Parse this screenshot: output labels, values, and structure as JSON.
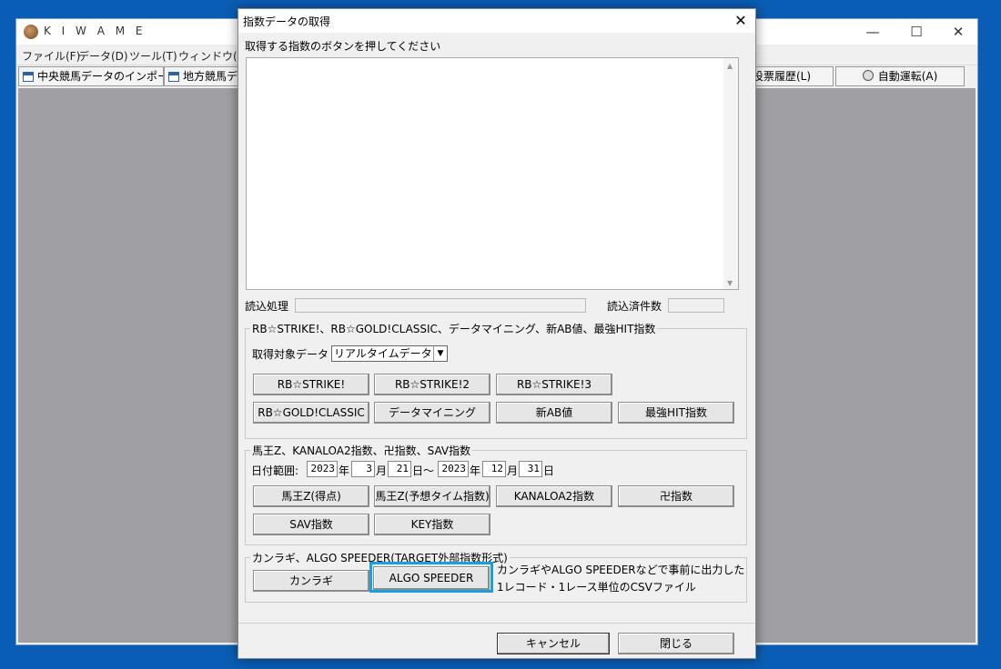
{
  "main_window": {
    "title": "K I W A M E",
    "controls": {
      "minimize": "—",
      "maximize": "☐",
      "close": "✕"
    },
    "menu": [
      "ファイル(F)",
      "データ(D)",
      "ツール(T)",
      "ウィンドウ(W)"
    ],
    "toolbar": {
      "left1": "中央競馬データのインポート(J)",
      "left2": "地方競馬デ",
      "right1": "投票履歴(L)",
      "right2": "自動運転(A)"
    }
  },
  "dialog": {
    "title": "指数データの取得",
    "close": "✕",
    "instruction": "取得する指数のボタンを押してください",
    "progress_label": "読込処理",
    "count_label": "読込済件数",
    "scroll_up": "▲",
    "scroll_down": "▼",
    "group1": {
      "label": "RB☆STRIKE!、RB☆GOLD!CLASSIC、データマイニング、新AB値、最強HIT指数",
      "target_label": "取得対象データ",
      "target_value": "リアルタイムデータ",
      "buttons": [
        "RB☆STRIKE!",
        "RB☆STRIKE!2",
        "RB☆STRIKE!3",
        "RB☆GOLD!CLASSIC",
        "データマイニング",
        "新AB値",
        "最強HIT指数"
      ]
    },
    "group2": {
      "label": "馬王Z、KANALOA2指数、卍指数、SAV指数",
      "date_label": "日付範囲:",
      "from": {
        "year": "2023",
        "month": "3",
        "day": "21"
      },
      "to": {
        "year": "2023",
        "month": "12",
        "day": "31"
      },
      "year_unit": "年",
      "month_unit": "月",
      "day_unit": "日",
      "range_sep": "日～",
      "buttons": [
        "馬王Z(得点)",
        "馬王Z(予想タイム指数)",
        "KANALOA2指数",
        "卍指数",
        "SAV指数",
        "KEY指数"
      ]
    },
    "group3": {
      "label": "カンラギ、ALGO SPEEDER(TARGET外部指数形式)",
      "buttons": [
        "カンラギ",
        "ALGO SPEEDER"
      ],
      "description_line1": "カンラギやALGO SPEEDERなどで事前に出力した",
      "description_line2": "1レコード・1レース単位のCSVファイル"
    },
    "footer": {
      "cancel": "キャンセル",
      "close": "閉じる"
    }
  },
  "colors": {
    "desktop": "#0a5db4",
    "highlight": "#1a9fe0",
    "mdi": "#a0a0a4"
  }
}
